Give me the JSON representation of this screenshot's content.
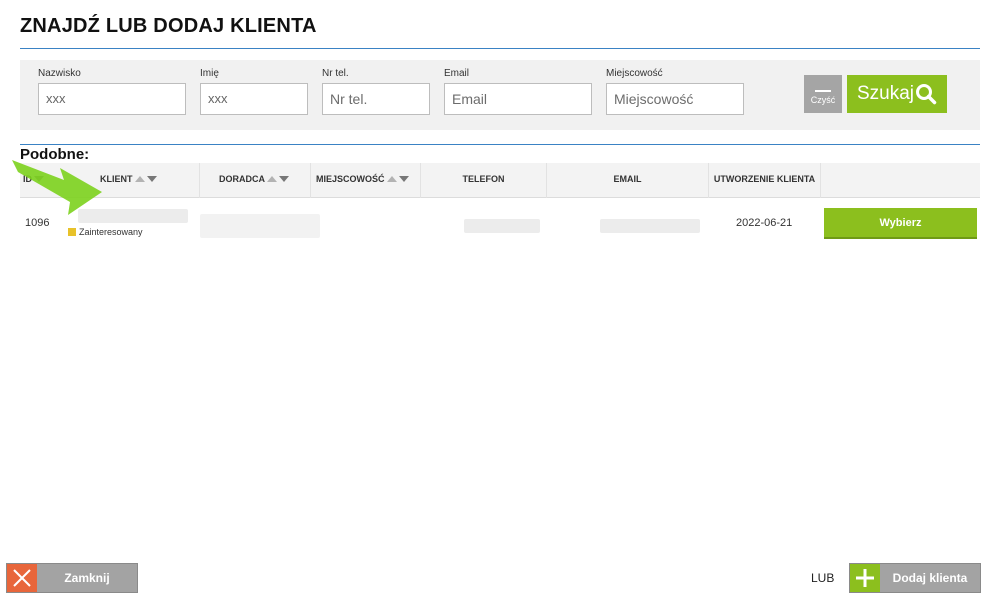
{
  "header": {
    "title": "ZNAJDŹ LUB DODAJ KLIENTA"
  },
  "search": {
    "fields": [
      {
        "label": "Nazwisko",
        "value": "xxx",
        "placeholder": "Nazwisko"
      },
      {
        "label": "Imię",
        "value": "xxx",
        "placeholder": "Imię"
      },
      {
        "label": "Nr tel.",
        "value": "",
        "placeholder": "Nr tel."
      },
      {
        "label": "Email",
        "value": "",
        "placeholder": "Email"
      },
      {
        "label": "Miejscowość",
        "value": "",
        "placeholder": "Miejscowość"
      }
    ],
    "clear_label": "Czyść",
    "search_label": "Szukaj"
  },
  "results": {
    "heading": "Podobne:",
    "columns": [
      "ID",
      "KLIENT",
      "DORADCA",
      "MIEJSCOWOŚĆ",
      "TELEFON",
      "EMAIL",
      "UTWORZENIE KLIENTA"
    ],
    "rows": [
      {
        "id": "1096",
        "status": "Zainteresowany",
        "status_color": "#e8c22a",
        "created": "2022-06-21",
        "select_label": "Wybierz"
      }
    ]
  },
  "footer": {
    "close_label": "Zamknij",
    "or_label": "LUB",
    "add_label": "Dodaj klienta"
  },
  "colors": {
    "accent_green": "#8cbf1e",
    "close_orange": "#e8663b",
    "rule_blue": "#3a82c4",
    "button_gray": "#a3a3a3"
  }
}
